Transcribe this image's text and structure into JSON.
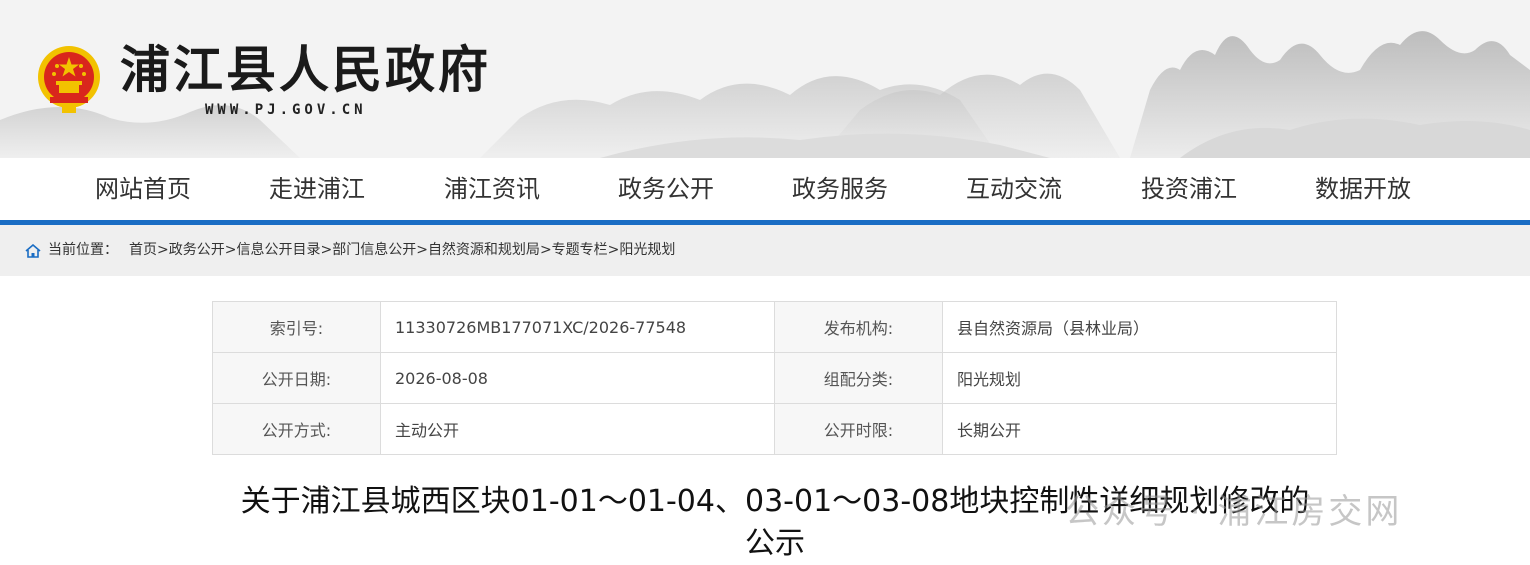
{
  "header": {
    "site_title": "浦江县人民政府",
    "site_domain": "WWW.PJ.GOV.CN"
  },
  "nav": {
    "items": [
      "网站首页",
      "走进浦江",
      "浦江资讯",
      "政务公开",
      "政务服务",
      "互动交流",
      "投资浦江",
      "数据开放"
    ]
  },
  "breadcrumb": {
    "label": "当前位置：",
    "items": [
      "首页",
      "政务公开",
      "信息公开目录",
      "部门信息公开",
      "自然资源和规划局",
      "专题专栏",
      "阳光规划"
    ],
    "separator": ">"
  },
  "info": {
    "index_label": "索引号:",
    "index_value": "11330726MB177071XC/2026-77548",
    "publisher_label": "发布机构:",
    "publisher_value": "县自然资源局（县林业局）",
    "date_label": "公开日期:",
    "date_value": "2026-08-08",
    "category_label": "组配分类:",
    "category_value": "阳光规划",
    "method_label": "公开方式:",
    "method_value": "主动公开",
    "period_label": "公开时限:",
    "period_value": "长期公开"
  },
  "article": {
    "title_line1": "关于浦江县城西区块01-01～01-04、03-01～03-08地块控制性详细规划修改的",
    "title_line2": "公示"
  },
  "watermark": "公众号 · 浦江房交网",
  "icons": {
    "emblem": "national-emblem-icon",
    "home": "home-icon"
  },
  "colors": {
    "nav_underline": "#1a6dc4",
    "header_bg": "#f3f3f3",
    "emblem_red": "#d9261c",
    "emblem_gold": "#f2c200"
  }
}
